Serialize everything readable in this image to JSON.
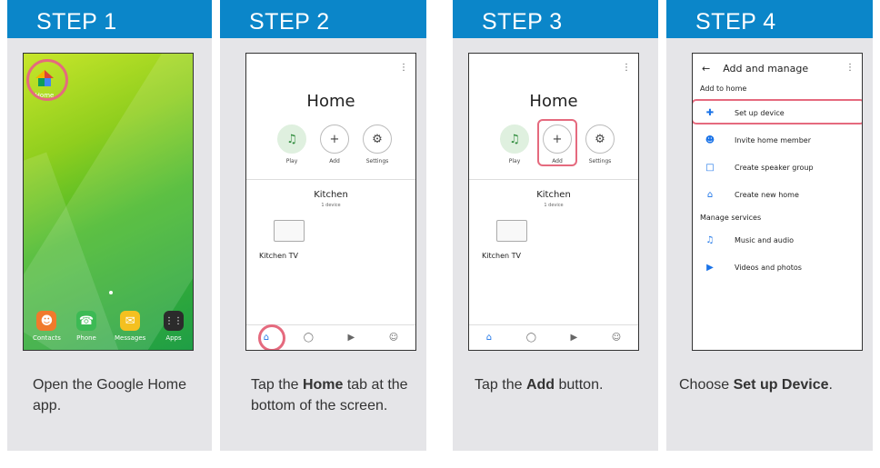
{
  "steps": [
    {
      "title": "STEP 1",
      "desc_plain": "Open the Google Home app."
    },
    {
      "title": "STEP 2",
      "desc_pre": "Tap the ",
      "desc_bold": "Home",
      "desc_post": " tab at the bottom of the screen."
    },
    {
      "title": "STEP 3",
      "desc_pre": "Tap the ",
      "desc_bold": "Add",
      "desc_post": " button."
    },
    {
      "title": "STEP 4",
      "desc_pre": "Choose ",
      "desc_bold": "Set up Device",
      "desc_post": "."
    }
  ],
  "step1": {
    "home_label": "Home",
    "dock": [
      "Contacts",
      "Phone",
      "Messages",
      "Apps"
    ]
  },
  "ghome": {
    "title": "Home",
    "actions": [
      "Play",
      "Add",
      "Settings"
    ],
    "room": "Kitchen",
    "room_sub": "1 device",
    "device": "Kitchen TV"
  },
  "manage": {
    "title": "Add and manage",
    "section1": "Add to home",
    "items1": [
      "Set up device",
      "Invite home member",
      "Create speaker group",
      "Create new home"
    ],
    "section2": "Manage services",
    "items2": [
      "Music and audio",
      "Videos and photos"
    ]
  },
  "colors": {
    "header": "#0b86c9",
    "highlight": "#e56a7e",
    "accent": "#1a73e8"
  }
}
